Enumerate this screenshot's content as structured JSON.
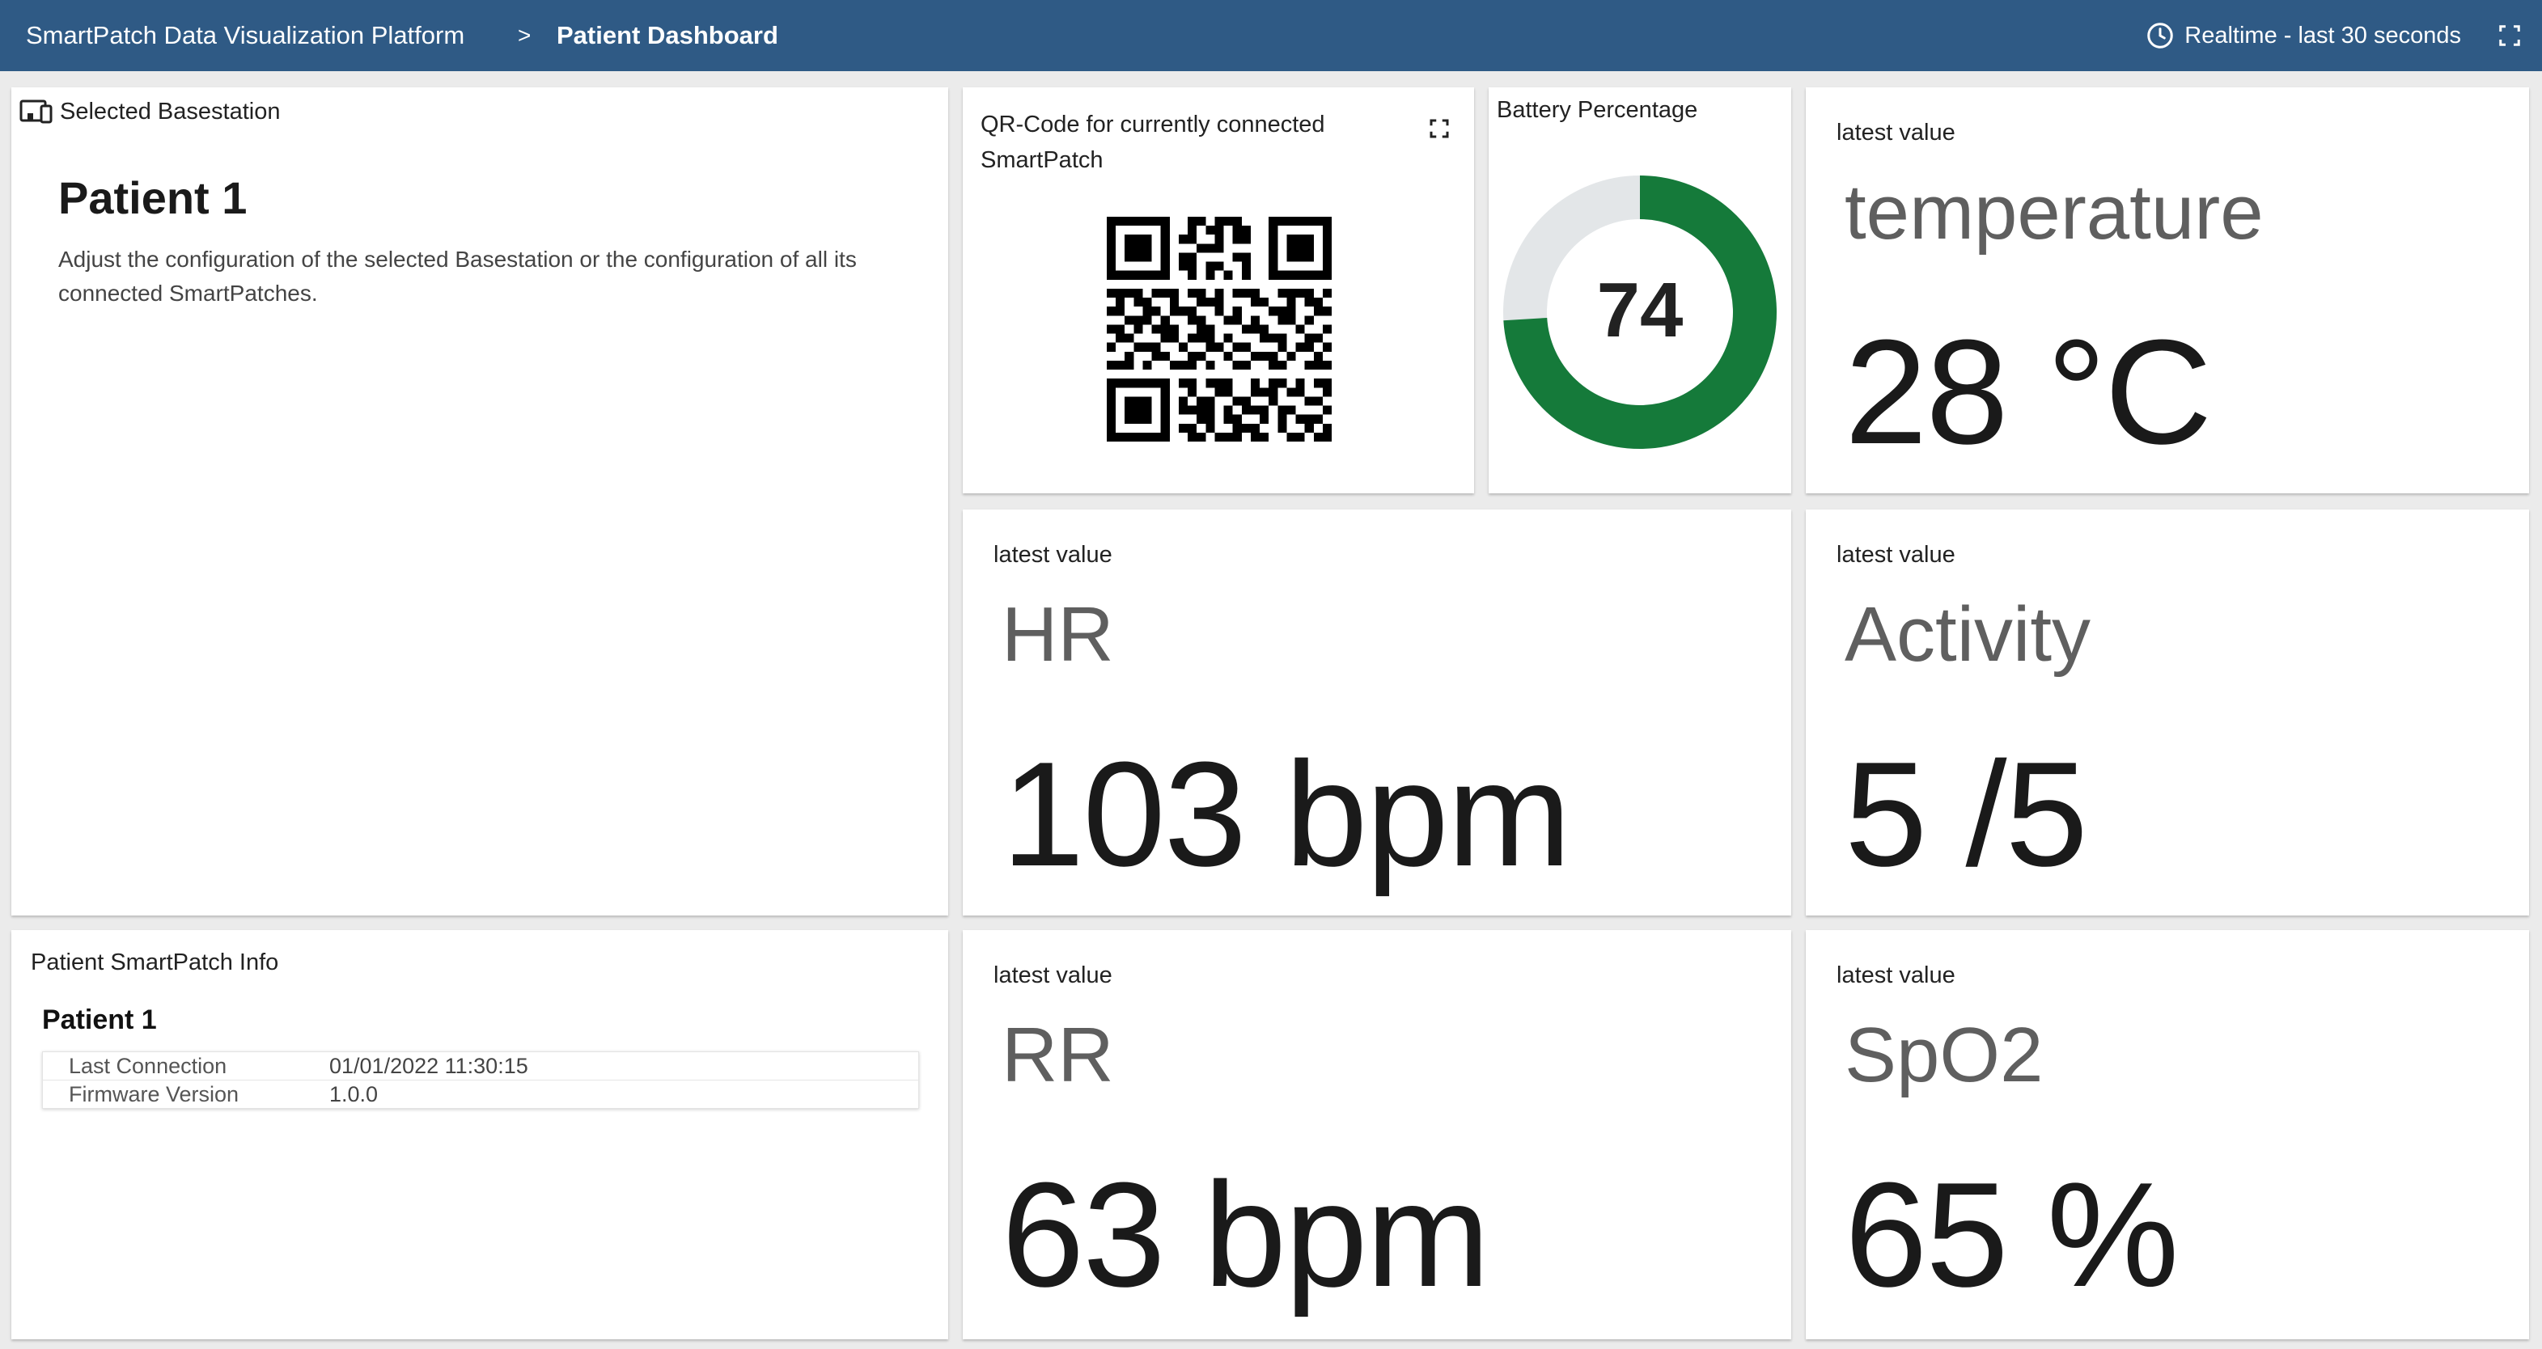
{
  "header": {
    "app_title": "SmartPatch Data Visualization Platform",
    "separator": ">",
    "current_page": "Patient Dashboard",
    "time_range_label": "Realtime - last 30 seconds",
    "background_color": "#2f5a85"
  },
  "basestation_panel": {
    "title": "Selected Basestation",
    "icon": "devices-icon",
    "patient_name": "Patient 1",
    "description": "Adjust the configuration of the selected Basestation or the configuration of all its connected SmartPatches."
  },
  "qr_panel": {
    "title": "QR-Code for currently connected SmartPatch",
    "icon": "expand-icon"
  },
  "battery_panel": {
    "title": "Battery Percentage",
    "value": 74,
    "max": 100,
    "fill_color": "#157a3a",
    "track_color": "#e3e6e8"
  },
  "metrics": [
    {
      "label": "latest value",
      "name": "temperature",
      "value": "28 °C"
    },
    {
      "label": "latest value",
      "name": "HR",
      "value": "103 bpm"
    },
    {
      "label": "latest value",
      "name": "Activity",
      "value": "5 /5"
    },
    {
      "label": "latest value",
      "name": "RR",
      "value": "63 bpm"
    },
    {
      "label": "latest value",
      "name": "SpO2",
      "value": "65 %"
    }
  ],
  "info_panel": {
    "title": "Patient SmartPatch Info",
    "patient_name": "Patient 1",
    "rows": [
      {
        "key": "Last Connection",
        "value": "01/01/2022 11:30:15"
      },
      {
        "key": "Firmware Version",
        "value": "1.0.0"
      }
    ]
  }
}
